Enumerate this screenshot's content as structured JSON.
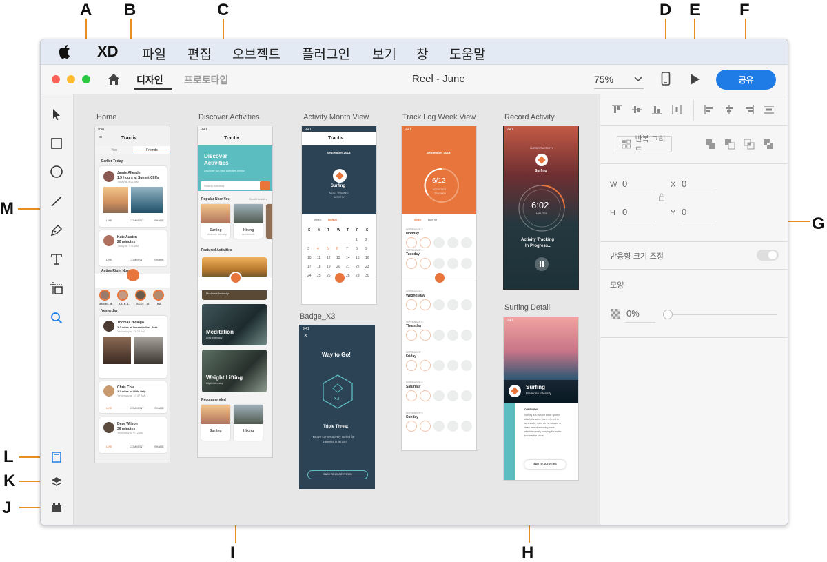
{
  "callouts": {
    "A": "A",
    "B": "B",
    "C": "C",
    "D": "D",
    "E": "E",
    "F": "F",
    "G": "G",
    "H": "H",
    "I": "I",
    "J": "J",
    "K": "K",
    "L": "L",
    "M": "M"
  },
  "menubar": {
    "app": "XD",
    "items": [
      "파일",
      "편집",
      "오브젝트",
      "플러그인",
      "보기",
      "창",
      "도움말"
    ]
  },
  "titlebar": {
    "tab_design": "디자인",
    "tab_prototype": "프로토타입",
    "doc_title": "Reel - June",
    "zoom": "75%",
    "share": "공유"
  },
  "colors": {
    "accent": "#1f7ce6",
    "orange": "#e8763c",
    "teal": "#5cbdc0",
    "navy": "#2c4355"
  },
  "artboards": {
    "home": {
      "label": "Home",
      "brand": "Tractiv",
      "tab1": "You",
      "tab2": "Friends",
      "section1": "Earlier Today",
      "section2": "Yesterday",
      "post1_name": "Jamie Allender",
      "post1_text": "surfed for",
      "post1_detail": "1.5 Hours at Sunset Cliffs",
      "post1_time": "Today at 8:21 AM",
      "post2_name": "Kate Austen",
      "post2_text": "meditated for",
      "post2_detail": "20 minutes",
      "post2_time": "Today at 7:41 AM",
      "post3_name": "Thomas Hidalgo",
      "post3_text": "hiked for",
      "post3_detail": "2.2 miles at Yosemite Nat. Park",
      "post3_time": "Yesterday at 11:28 AM",
      "post4_name": "Chris Cole",
      "post4_text": "cycled for",
      "post4_detail": "2.2 miles in Little Italy",
      "post4_time": "Yesterday at 10:37 AM",
      "post5_name": "Dave Wilson",
      "post5_text": "lifted weights for",
      "post5_detail": "36 minutes",
      "post5_time": "Yesterday at 9:12 AM",
      "like": "LIKE",
      "comment": "COMMENT",
      "share": "SHARE",
      "active": "Active Right Now",
      "friend1": "ANGEL M.",
      "friend2": "KATE A.",
      "friend3": "SCOTT M.",
      "friend4": "KA"
    },
    "discover": {
      "label": "Discover Activities",
      "brand": "Tractiv",
      "title1": "Discover",
      "title2": "Activities",
      "subtitle": "Discover fun new activities below",
      "search": "Search Activities",
      "popular": "Popular Near You",
      "see_all": "See All Activities",
      "pop1": "Surfing",
      "pop1_sub": "Moderate Intensity",
      "pop2": "Hiking",
      "pop2_sub": "Low Intensity",
      "featured": "Featured Activities",
      "feat0_sub": "Moderate Intensity",
      "feat1": "Meditation",
      "feat1_sub": "Low Intensity",
      "feat2": "Weight Lifting",
      "feat2_sub": "High Intensity",
      "recommended": "Recommended",
      "rec1": "Surfing",
      "rec2": "Hiking"
    },
    "month": {
      "label": "Activity Month View",
      "brand": "Tractiv",
      "month": "September 2018",
      "activity": "Surfing",
      "sub1": "MOST TRACKED",
      "sub2": "ACTIVITY",
      "view1": "WEEK",
      "view2": "MONTH",
      "days": [
        "S",
        "M",
        "T",
        "W",
        "T",
        "F",
        "S"
      ],
      "dates": [
        "",
        "",
        "",
        "",
        "",
        "1",
        "2",
        "3",
        "4",
        "5",
        "6",
        "7",
        "8",
        "9",
        "10",
        "11",
        "12",
        "13",
        "14",
        "15",
        "16",
        "17",
        "18",
        "19",
        "20",
        "21",
        "22",
        "23",
        "24",
        "25",
        "26",
        "27",
        "28",
        "29",
        "30"
      ]
    },
    "track": {
      "label": "Track Log Week View",
      "month": "September 2018",
      "count": "6/12",
      "sub1": "ACTIVITIES",
      "sub2": "TRACKED",
      "view1": "WEEK",
      "view2": "MONTH",
      "rows": [
        {
          "date": "SEPTEMBER 3",
          "day": "Monday"
        },
        {
          "date": "SEPTEMBER 4",
          "day": "Tuesday"
        },
        {
          "date": "SEPTEMBER 5",
          "day": "Wednesday"
        },
        {
          "date": "SEPTEMBER 6",
          "day": "Thursday"
        },
        {
          "date": "SEPTEMBER 7",
          "day": "Friday"
        },
        {
          "date": "SEPTEMBER 8",
          "day": "Saturday"
        },
        {
          "date": "SEPTEMBER 9",
          "day": "Sunday"
        }
      ]
    },
    "record": {
      "label": "Record Activity",
      "current": "CURRENT ACTIVITY",
      "activity": "Surfing",
      "time": "6:02",
      "unit": "MINUTES",
      "status1": "Activity Tracking",
      "status2": "In Progress..."
    },
    "badge": {
      "label": "Badge_X3",
      "title": "Way to Go!",
      "badge": "X3",
      "name": "Triple Threat",
      "desc1": "You've consecutively surfed for",
      "desc2": "3 weeks in a row!",
      "button": "BACK TO MY ACTIVITIES"
    },
    "surf": {
      "label": "Surfing Detail",
      "title": "Surfing",
      "sub": "Moderate Intensity",
      "overview": "OVERVIEW",
      "body": [
        "Surfing is a surface water sport in",
        "which the wave rider, referred to",
        "as a surfer, rides on the forward or",
        "deep face of a moving wave,",
        "which is usually carrying the surfer",
        "towards the shore."
      ],
      "button": "ADD TO ACTIVITIES"
    }
  },
  "inspector": {
    "repeat_grid": "반복 그리드",
    "w_label": "W",
    "w": "0",
    "x_label": "X",
    "x": "0",
    "h_label": "H",
    "h": "0",
    "y_label": "Y",
    "y": "0",
    "responsive": "반응형 크기 조정",
    "appearance": "모양",
    "opacity": "0%"
  }
}
